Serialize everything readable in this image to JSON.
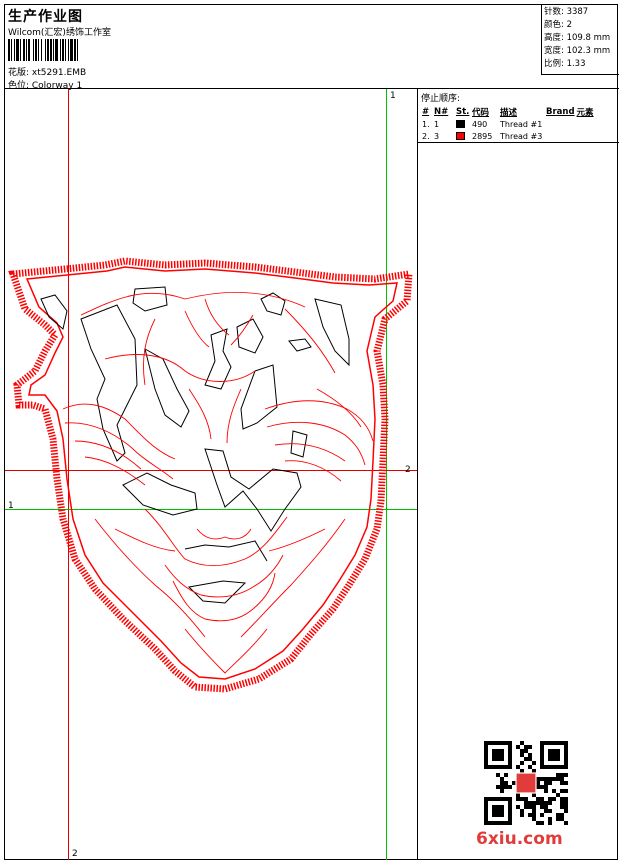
{
  "header": {
    "title": "生产作业图",
    "company": "Wilcom(汇宏)绣饰工作室",
    "design": "花版: xt5291.EMB",
    "colorway": "色位: Colorway 1"
  },
  "stats": {
    "stitches": "针数: 3387",
    "colors": "颜色: 2",
    "height": "高度: 109.8 mm",
    "width": "宽度: 102.3 mm",
    "scale": "比例: 1.33"
  },
  "stop_sequence": {
    "title": "停止顺序:",
    "columns": [
      "#",
      "N#",
      "St.",
      "代码",
      "描述",
      "Brand",
      "元素"
    ],
    "rows": [
      {
        "num": "1.",
        "needle": "1",
        "color": "#000000",
        "stitches": "490",
        "description": "Thread #1"
      },
      {
        "num": "2.",
        "needle": "3",
        "color": "#ff0000",
        "stitches": "2895",
        "description": "Thread #3"
      }
    ]
  },
  "guides": {
    "v1_label": "1",
    "h2_label": "2",
    "h1_label": "1",
    "v2_label": "2"
  },
  "watermark": "6xiu.com",
  "colors": {
    "guide_red": "#e00000",
    "guide_green": "#00c000",
    "outline_red": "#ff0000",
    "stitch_black": "#000000"
  }
}
